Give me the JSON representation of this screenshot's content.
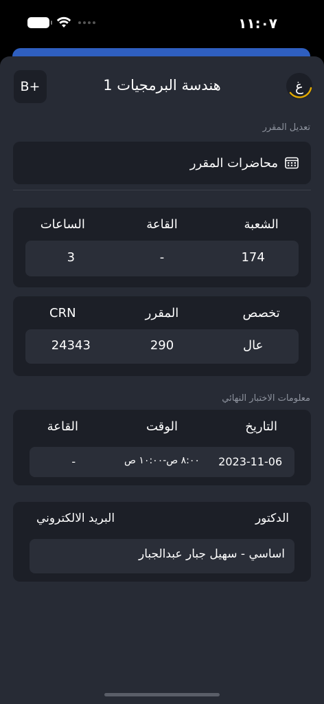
{
  "status": {
    "time": "١١:٠٧"
  },
  "header": {
    "grade": "B+",
    "title": "هندسة البرمجيات 1",
    "avatar_letter": "غ"
  },
  "edit_course_label": "تعديل المقرر",
  "lectures_button": {
    "label": "محاضرات المقرر",
    "icon": "calendar-icon"
  },
  "section_info": {
    "headers": [
      "الشعبة",
      "القاعة",
      "الساعات"
    ],
    "values": [
      "174",
      "-",
      "3"
    ]
  },
  "course_info": {
    "headers": [
      "تخصص",
      "المقرر",
      "CRN"
    ],
    "values": [
      "عال",
      "290",
      "24343"
    ]
  },
  "final_exam": {
    "label": "معلومات الاختبار النهائي",
    "headers": [
      "التاريخ",
      "الوقت",
      "القاعة"
    ],
    "values": [
      "2023-11-06",
      "٨:٠٠ ص-١٠:٠٠ ص",
      "-"
    ]
  },
  "instructor": {
    "doctor_label": "الدكتور",
    "email_label": "البريد الالكتروني",
    "name": "اساسي - سهيل جبار عبدالجبار"
  },
  "colors": {
    "background": "#272b35",
    "card": "#1c1f27",
    "inner": "#2a2e38",
    "accent_blue": "#2f5fc0",
    "avatar_ring": "#e0a800"
  }
}
